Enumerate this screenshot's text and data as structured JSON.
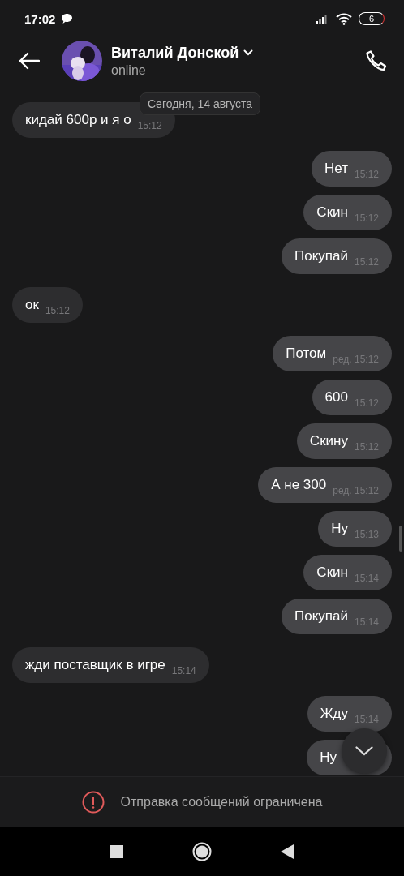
{
  "status_bar": {
    "time": "17:02",
    "battery": "6"
  },
  "header": {
    "name": "Виталий Донской",
    "status": "online"
  },
  "date_label": "Сегодня, 14 августа",
  "messages": [
    {
      "kind": "in",
      "text": "кидай 600р и я о",
      "time": "15:12"
    },
    {
      "kind": "out",
      "text": "Нет",
      "time": "15:12"
    },
    {
      "kind": "out",
      "text": "Скин",
      "time": "15:12"
    },
    {
      "kind": "out",
      "text": "Покупай",
      "time": "15:12"
    },
    {
      "kind": "in",
      "text": "ок",
      "time": "15:12"
    },
    {
      "kind": "out",
      "text": "Потом",
      "time": "15:12",
      "edited": "ред."
    },
    {
      "kind": "out",
      "text": "600",
      "time": "15:12"
    },
    {
      "kind": "out",
      "text": "Скину",
      "time": "15:12"
    },
    {
      "kind": "out",
      "text": "А не 300",
      "time": "15:12",
      "edited": "ред."
    },
    {
      "kind": "out",
      "text": "Ну",
      "time": "15:13"
    },
    {
      "kind": "out",
      "text": "Скин",
      "time": "15:14"
    },
    {
      "kind": "out",
      "text": "Покупай",
      "time": "15:14"
    },
    {
      "kind": "in",
      "text": "жди поставщик в игре",
      "time": "15:14"
    },
    {
      "kind": "out",
      "text": "Жду",
      "time": "15:14"
    },
    {
      "kind": "out",
      "text": "Ну"
    }
  ],
  "notice": "Отправка сообщений ограничена"
}
